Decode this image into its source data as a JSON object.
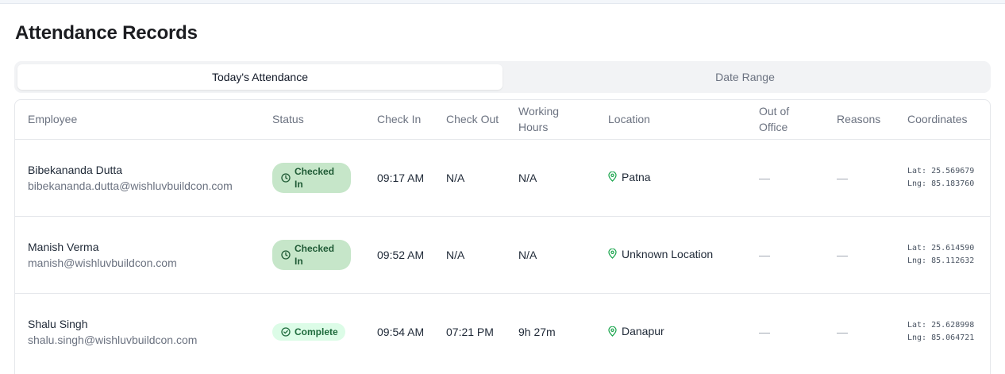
{
  "page": {
    "title": "Attendance Records"
  },
  "tabs": [
    {
      "label": "Today's Attendance",
      "active": true
    },
    {
      "label": "Date Range",
      "active": false
    }
  ],
  "table": {
    "columns": {
      "employee": "Employee",
      "status": "Status",
      "check_in": "Check In",
      "check_out": "Check Out",
      "working_hours": "Working Hours",
      "location": "Location",
      "out_of_office": "Out of Office",
      "reasons": "Reasons",
      "coordinates": "Coordinates"
    },
    "rows": [
      {
        "name": "Bibekananda Dutta",
        "email": "bibekananda.dutta@wishluvbuildcon.com",
        "status": "Checked In",
        "status_icon": "clock-icon",
        "check_in": "09:17 AM",
        "check_out": "N/A",
        "working_hours": "N/A",
        "location": "Patna",
        "out_of_office": "—",
        "reasons": "—",
        "lat": "Lat: 25.569679",
        "lng": "Lng: 85.183760"
      },
      {
        "name": "Manish Verma",
        "email": "manish@wishluvbuildcon.com",
        "status": "Checked In",
        "status_icon": "clock-icon",
        "check_in": "09:52 AM",
        "check_out": "N/A",
        "working_hours": "N/A",
        "location": "Unknown Location",
        "out_of_office": "—",
        "reasons": "—",
        "lat": "Lat: 25.614590",
        "lng": "Lng: 85.112632"
      },
      {
        "name": "Shalu Singh",
        "email": "shalu.singh@wishluvbuildcon.com",
        "status": "Complete",
        "status_icon": "check-circle-icon",
        "check_in": "09:54 AM",
        "check_out": "07:21 PM",
        "working_hours": "9h 27m",
        "location": "Danapur",
        "out_of_office": "—",
        "reasons": "—",
        "lat": "Lat: 25.628998",
        "lng": "Lng: 85.064721"
      }
    ]
  },
  "colors": {
    "checked_in_badge": "#c6e6c9",
    "complete_badge": "#dcfce7",
    "badge_text": "#1f5a35"
  }
}
